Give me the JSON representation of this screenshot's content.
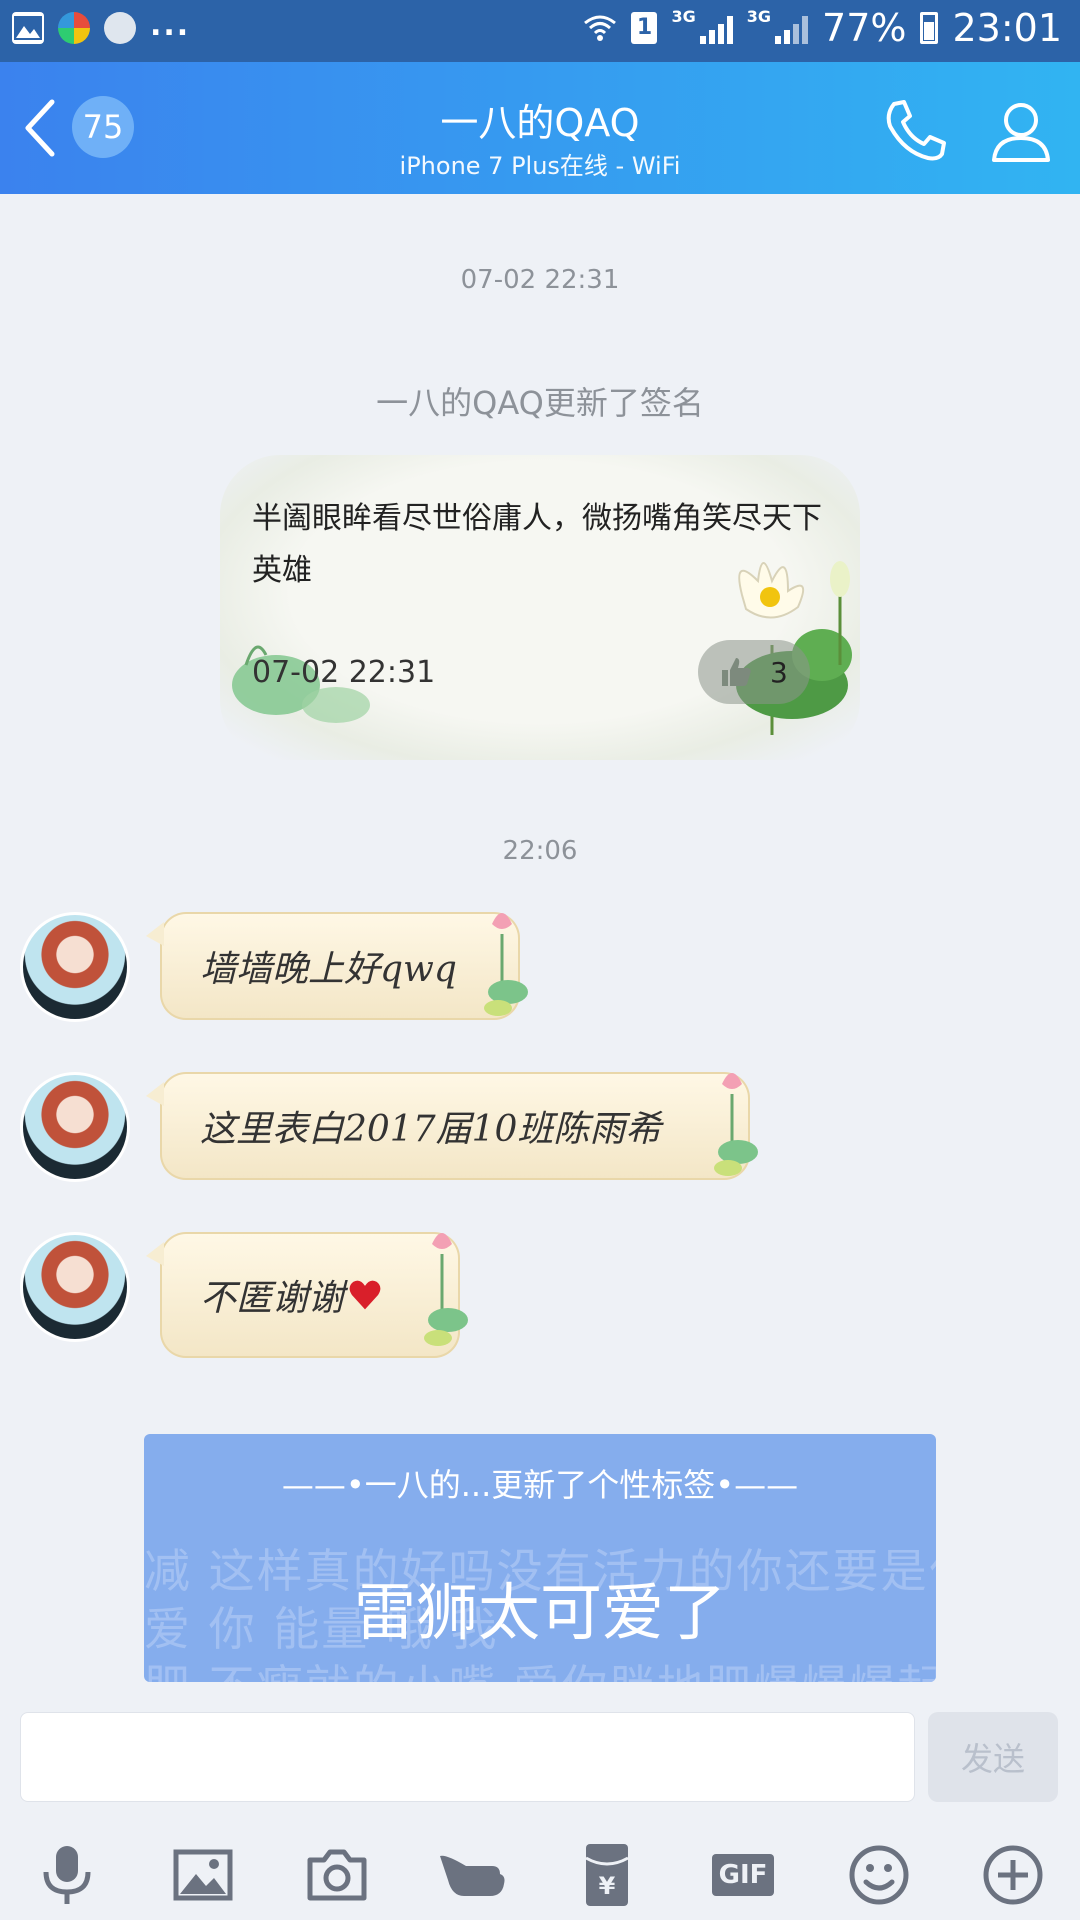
{
  "status_bar": {
    "battery_percent": "77%",
    "time": "23:01",
    "network_1": "3G",
    "network_2": "3G",
    "sim_label": "1",
    "overflow": "..."
  },
  "header": {
    "unread_count": "75",
    "title": "一八的QAQ",
    "subtitle": "iPhone 7 Plus在线 - WiFi"
  },
  "conversation": {
    "timestamp_1": "07-02 22:31",
    "system_notice": "一八的QAQ更新了签名",
    "signature_card": {
      "text": "半阖眼眸看尽世俗庸人，微扬嘴角笑尽天下英雄",
      "time": "07-02 22:31",
      "like_count": "3"
    },
    "timestamp_2": "22:06",
    "messages": [
      {
        "text": "墙墙晚上好qwq"
      },
      {
        "text": "这里表白2017届10班陈雨希"
      },
      {
        "text": "不匿谢谢"
      }
    ],
    "tag_card": {
      "header": "——•一八的...更新了个性标签•——",
      "tag": "雷狮太可爱了",
      "bg_text_1": "减 这样真的好吗没有活力的你还要是什么",
      "bg_text_2": "爱 你 能量 哦 我",
      "bg_text_3": "肥 不瘦就的小嘴 爱你胖地肥爆爆爆起来"
    }
  },
  "input": {
    "value": "",
    "placeholder": "",
    "send_label": "发送"
  },
  "toolbar": {
    "gif_label": "GIF"
  },
  "colors": {
    "header_start": "#3b82ee",
    "header_end": "#31b4f2",
    "status_bar": "#2c63a8",
    "tag_card": "#85aded",
    "background": "#eef1f6"
  }
}
